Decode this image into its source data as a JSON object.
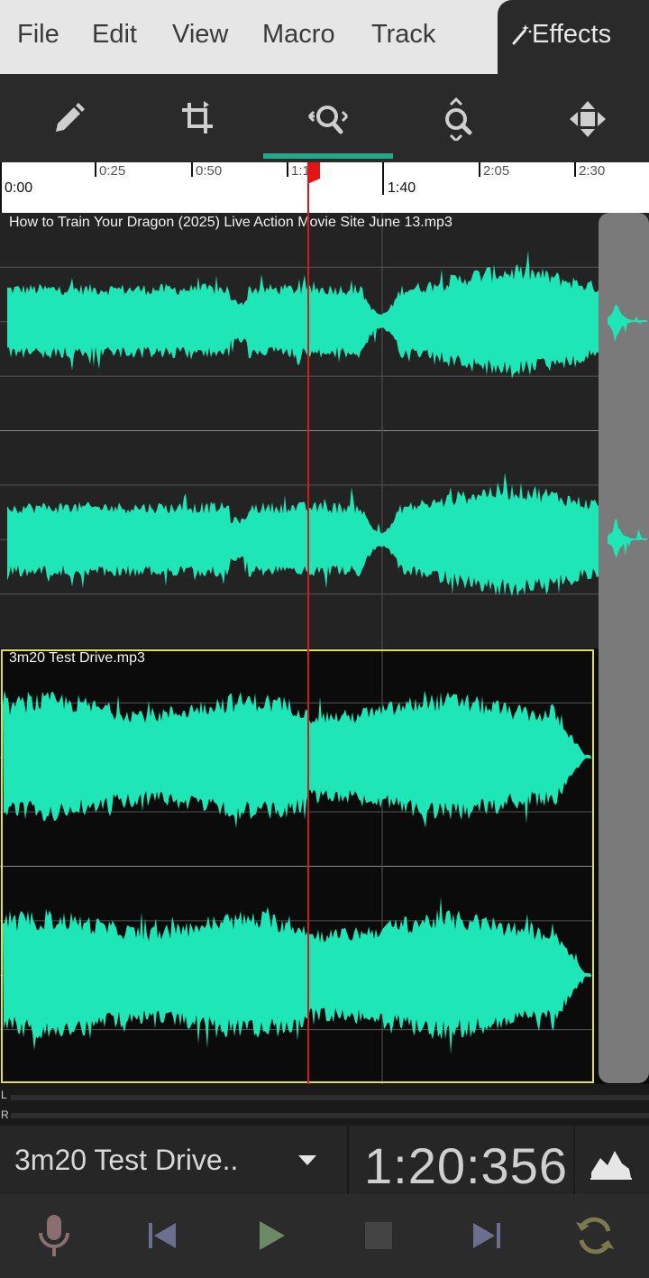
{
  "menu": {
    "items": [
      "File",
      "Edit",
      "View",
      "Macro",
      "Track"
    ],
    "effects_label": "Effects"
  },
  "toolbar": {
    "tools": [
      "pencil-icon",
      "crop-icon",
      "zoom-horizontal-icon",
      "zoom-vertical-icon",
      "move-icon"
    ],
    "active_index": 2,
    "accent": "#27a889"
  },
  "ruler": {
    "minor_labels": [
      "0:25",
      "0:50",
      "1:1",
      "2:05",
      "2:30"
    ],
    "major_labels": [
      "0:00",
      "1:40"
    ]
  },
  "tracks": [
    {
      "name": "How to Train Your Dragon (2025) Live Action  Movie Site June 13.mp3",
      "selected": false
    },
    {
      "name": "3m20 Test Drive.mp3",
      "selected": true
    }
  ],
  "meters": {
    "left": "L",
    "right": "R"
  },
  "infobar": {
    "track_select": "3m20 Test Drive..",
    "time": "1:20:356"
  },
  "colors": {
    "waveform": "#1fe6b6",
    "playhead": "#d21a1a",
    "selection": "#e6e03a"
  },
  "transport": [
    "microphone-icon",
    "skip-back-icon",
    "play-icon",
    "stop-icon",
    "skip-forward-icon",
    "loop-icon"
  ]
}
